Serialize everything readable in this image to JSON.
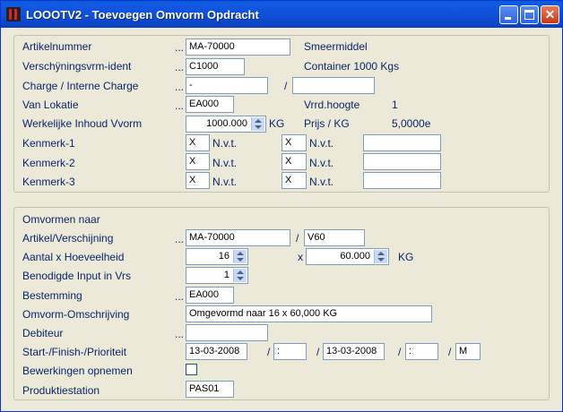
{
  "window": {
    "title": "LOOOTV2 - Toevoegen Omvorm Opdracht"
  },
  "panel1": {
    "artikelnummer": {
      "label": "Artikelnummer",
      "value": "MA-70000",
      "desc": "Smeermiddel"
    },
    "verschijning": {
      "label": "Verschÿningsvrm-ident",
      "value": "C1000",
      "desc": "Container 1000 Kgs"
    },
    "charge": {
      "label": "Charge / Interne Charge",
      "value": "-",
      "sep": "/",
      "value2": ""
    },
    "lokatie": {
      "label": "Van Lokatie",
      "value": "EA000",
      "vrrd_label": "Vrrd.hoogte",
      "vrrd_value": "1"
    },
    "inhoud": {
      "label": "Werkelijke Inhoud Vvorm",
      "value": "1000.000",
      "unit": "KG",
      "prijs_label": "Prijs / KG",
      "prijs_value": "5,0000e"
    },
    "kenmerken": [
      {
        "label": "Kenmerk-1",
        "code1": "X",
        "text1": "N.v.t.",
        "code2": "X",
        "text2": "N.v.t.",
        "extra": ""
      },
      {
        "label": "Kenmerk-2",
        "code1": "X",
        "text1": "N.v.t.",
        "code2": "X",
        "text2": "N.v.t.",
        "extra": ""
      },
      {
        "label": "Kenmerk-3",
        "code1": "X",
        "text1": "N.v.t.",
        "code2": "X",
        "text2": "N.v.t.",
        "extra": ""
      }
    ]
  },
  "panel2": {
    "header": "Omvormen naar",
    "artikel": {
      "label": "Artikel/Verschijning",
      "value": "MA-70000",
      "sep": "/",
      "value2": "V60"
    },
    "aantal": {
      "label": "Aantal x Hoeveelheid",
      "value": "16",
      "x": "x",
      "value2": "60.000",
      "unit": "KG"
    },
    "input": {
      "label": "Benodigde Input in Vrs",
      "value": "1"
    },
    "bestemming": {
      "label": "Bestemming",
      "value": "EA000"
    },
    "omschrijving": {
      "label": "Omvorm-Omschrijving",
      "value": "Omgevormd naar 16 x 60,000 KG"
    },
    "debiteur": {
      "label": "Debiteur",
      "value": ""
    },
    "start": {
      "label": "Start-/Finish-/Prioriteit",
      "start_date": "13-03-2008",
      "sep1": "/",
      "start_time": ":",
      "sep2": "/",
      "finish_date": "13-03-2008",
      "sep3": "/",
      "finish_time": ":",
      "sep4": "/",
      "prioriteit": "M"
    },
    "bewerkingen": {
      "label": "Bewerkingen opnemen",
      "checked": false
    },
    "produktiestation": {
      "label": "Produktiestation",
      "value": "PAS01"
    }
  },
  "dots": "..."
}
